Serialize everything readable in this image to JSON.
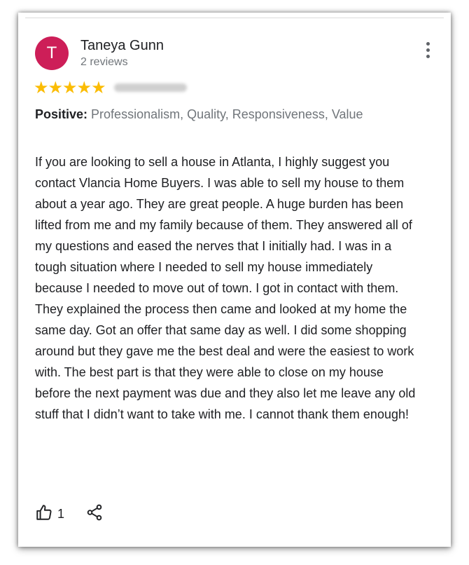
{
  "review": {
    "avatar_letter": "T",
    "avatar_color": "#cd1e58",
    "author_name": "Taneya Gunn",
    "review_count": "2 reviews",
    "rating_stars": "★★★★★",
    "rating_value": 5,
    "rating_max": 5,
    "star_color": "#fbbc04",
    "positive_label": "Positive:",
    "positive_values": "Professionalism, Quality, Responsiveness, Value",
    "text": "If you are looking to sell a house in Atlanta, I highly suggest you contact Vlancia Home Buyers. I was able to sell my house to them about a year ago. They are great people. A huge burden has been lifted from me and my family because of them. They answered all of my questions and eased the nerves that I initially had. I was in a tough situation where I needed to sell my house immediately because I needed to move out of town. I got in contact with them. They explained the process then came and looked at my home the same day. Got an offer that same day as well. I did some shopping around but they gave me the best deal and were the easiest to work with. The best part is that they were able to close on my house before the next payment was due and they also let me leave any old stuff that I didn’t want to take with me. I cannot thank them enough!",
    "like_count": "1"
  },
  "icons": {
    "more": "more-vert-icon",
    "like": "thumbs-up-icon",
    "share": "share-icon"
  }
}
